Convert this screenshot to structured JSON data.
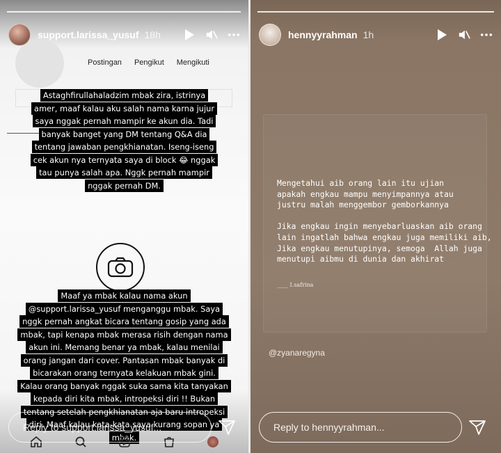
{
  "left_story": {
    "username": "support.larissa_yusuf",
    "time": "18h",
    "profile_stats": [
      "Postingan",
      "Pengikut",
      "Mengikuti"
    ],
    "caption_top": [
      "Astaghfirullahaladzim mbak zira, istrinya",
      "amer, maaf kalau aku salah nama karna jujur",
      "saya nggak pernah mampir ke akun dia. Tadi",
      "banyak banget yang DM tentang Q&A dia",
      "tentang jawaban pengkhianatan. Iseng-iseng",
      "cek akun nya ternyata saya di block 😂 nggak",
      "tau punya salah apa. Nggk pernah mampir",
      "nggak pernah DM."
    ],
    "caption_bottom": [
      "Maaf ya mbak kalau nama akun",
      "@support.larissa_yusuf menganggu mbak. Saya",
      "nggk pernah angkat bicara tentang gosip yang ada",
      "mbak, tapi kenapa mbak merasa risih dengan nama",
      "akun ini. Memang benar ya mbak, kalau menilai",
      "orang jangan dari cover. Pantasan mbak banyak di",
      "bicarakan orang ternyata kelakuan mbak gini.",
      "Kalau orang banyak nggak suka sama kita tanyakan",
      "kepada diri kita mbak, intropeksi diri !! Bukan",
      "tentang setelah pengkhianatan aja baru intropeksi",
      "diri. Maaf kalau kata-kata saya kurang sopan ya",
      "mbak."
    ],
    "reply_placeholder": "Reply to support.larissa_yusuf..."
  },
  "right_story": {
    "username": "hennyyrahman",
    "time": "1h",
    "quote_lines": [
      "Mengetahui aib orang lain itu ujian",
      "apakah engkau mampu menyimpannya atau",
      "justru malah menggembor gemborkannya",
      "",
      "Jika engkau ingin menyebarluaskan aib orang",
      "lain ingatlah bahwa engkau juga memiliki aib,",
      "Jika engkau menutupinya, semoga  Allah juga",
      "menutupi aibmu di dunia dan akhirat"
    ],
    "signature": "____ I.safrina",
    "mention": "@zyanaregyna",
    "reply_placeholder": "Reply to hennyyrahman..."
  },
  "icons": [
    "play-icon",
    "mute-icon",
    "more-icon",
    "camera-icon",
    "send-icon",
    "home-icon",
    "search-icon",
    "reels-icon",
    "shop-icon"
  ]
}
